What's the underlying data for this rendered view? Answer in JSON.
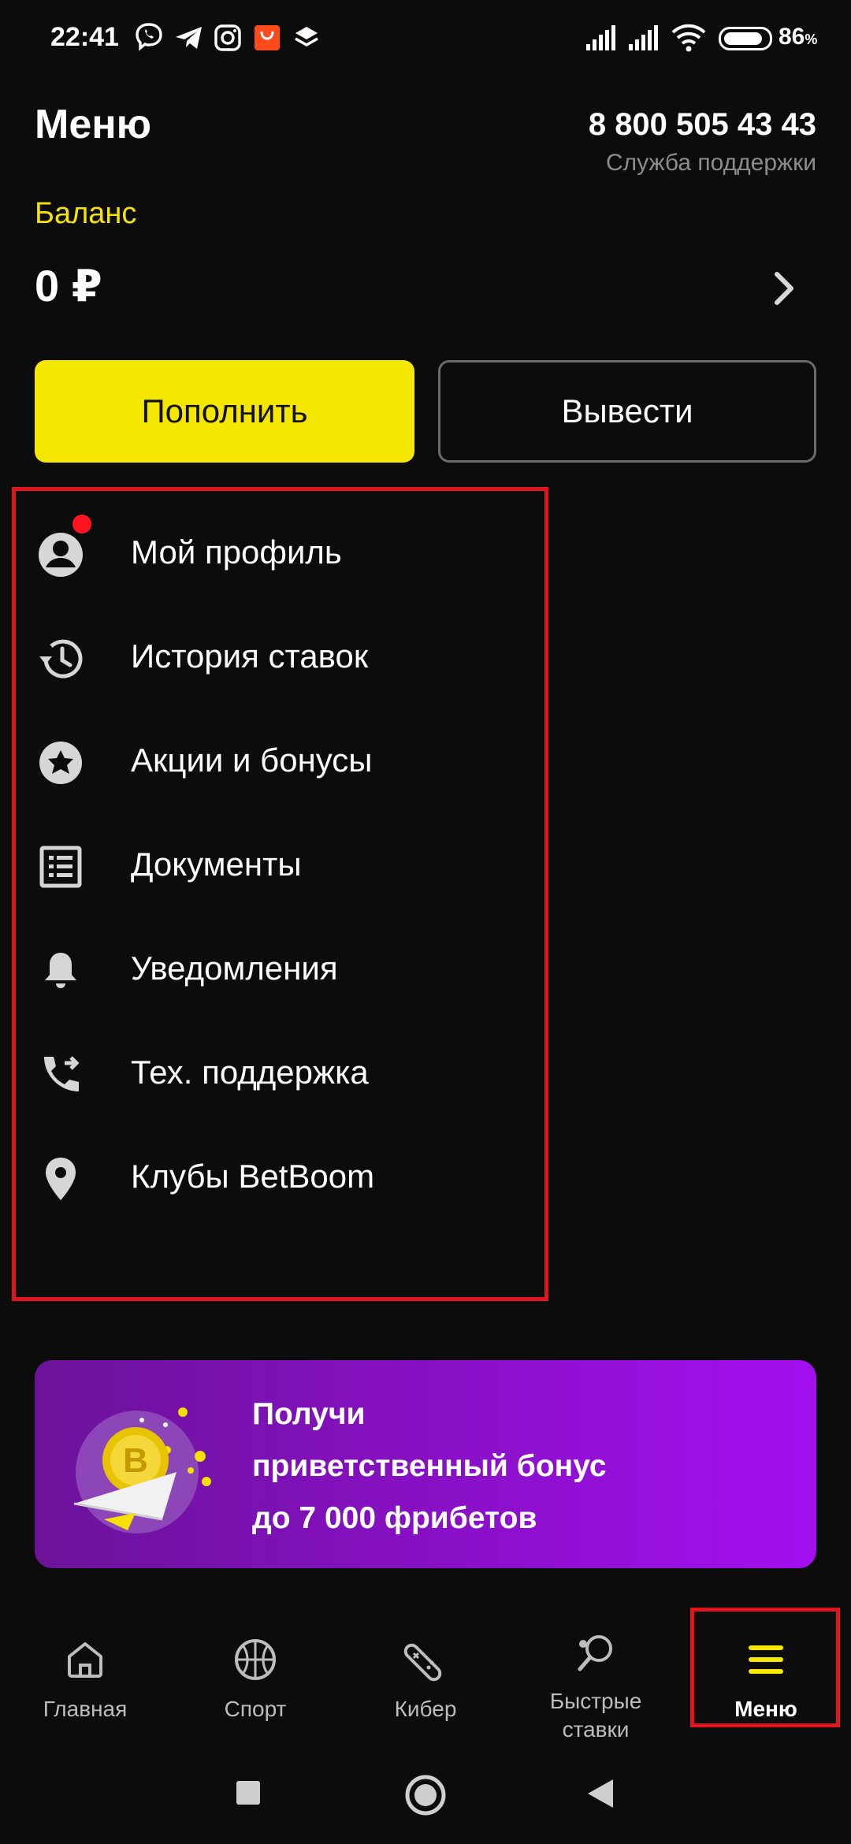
{
  "status_bar": {
    "time": "22:41",
    "battery_percent": "86",
    "battery_symbol": "%",
    "battery_level": 0.86,
    "notification_icons": [
      "viber-icon",
      "telegram-icon",
      "instagram-icon",
      "aliexpress-icon",
      "layers-app-icon"
    ],
    "system_icons": [
      "signal-icon",
      "signal-icon",
      "wifi-icon",
      "battery-icon"
    ]
  },
  "header": {
    "title": "Меню",
    "support_phone": "8 800 505 43 43",
    "support_label": "Служба поддержки"
  },
  "balance": {
    "label": "Баланс",
    "value": "0 ₽",
    "chevron_icon": "chevron-right-icon"
  },
  "actions": {
    "deposit_label": "Пополнить",
    "withdraw_label": "Вывести"
  },
  "menu": {
    "items": [
      {
        "label": "Мой профиль",
        "icon": "account-circle-icon",
        "has_notification": true
      },
      {
        "label": "История ставок",
        "icon": "history-icon"
      },
      {
        "label": "Акции и бонусы",
        "icon": "star-circle-icon"
      },
      {
        "label": "Документы",
        "icon": "document-list-icon"
      },
      {
        "label": "Уведомления",
        "icon": "bell-icon"
      },
      {
        "label": "Тех. поддержка",
        "icon": "phone-forward-icon"
      },
      {
        "label": "Клубы BetBoom",
        "icon": "location-pin-icon"
      }
    ]
  },
  "promo": {
    "line1": "Получи",
    "line2": "приветственный бонус",
    "line3": "до 7 000 фрибетов",
    "icon": "coin-envelope-icon"
  },
  "bottom_nav": {
    "items": [
      {
        "label": "Главная",
        "icon": "home-icon"
      },
      {
        "label": "Спорт",
        "icon": "basketball-icon"
      },
      {
        "label": "Кибер",
        "icon": "gamepad-icon"
      },
      {
        "label_line1": "Быстрые",
        "label_line2": "ставки",
        "icon": "ping-pong-icon"
      },
      {
        "label": "Меню",
        "icon": "hamburger-icon",
        "active": true
      }
    ]
  },
  "colors": {
    "background": "#0c0c0c",
    "accent_yellow": "#f6e700",
    "highlight_red": "#e0151d",
    "promo_purple": "#8a10c8",
    "muted_text": "#8d8d8d"
  }
}
